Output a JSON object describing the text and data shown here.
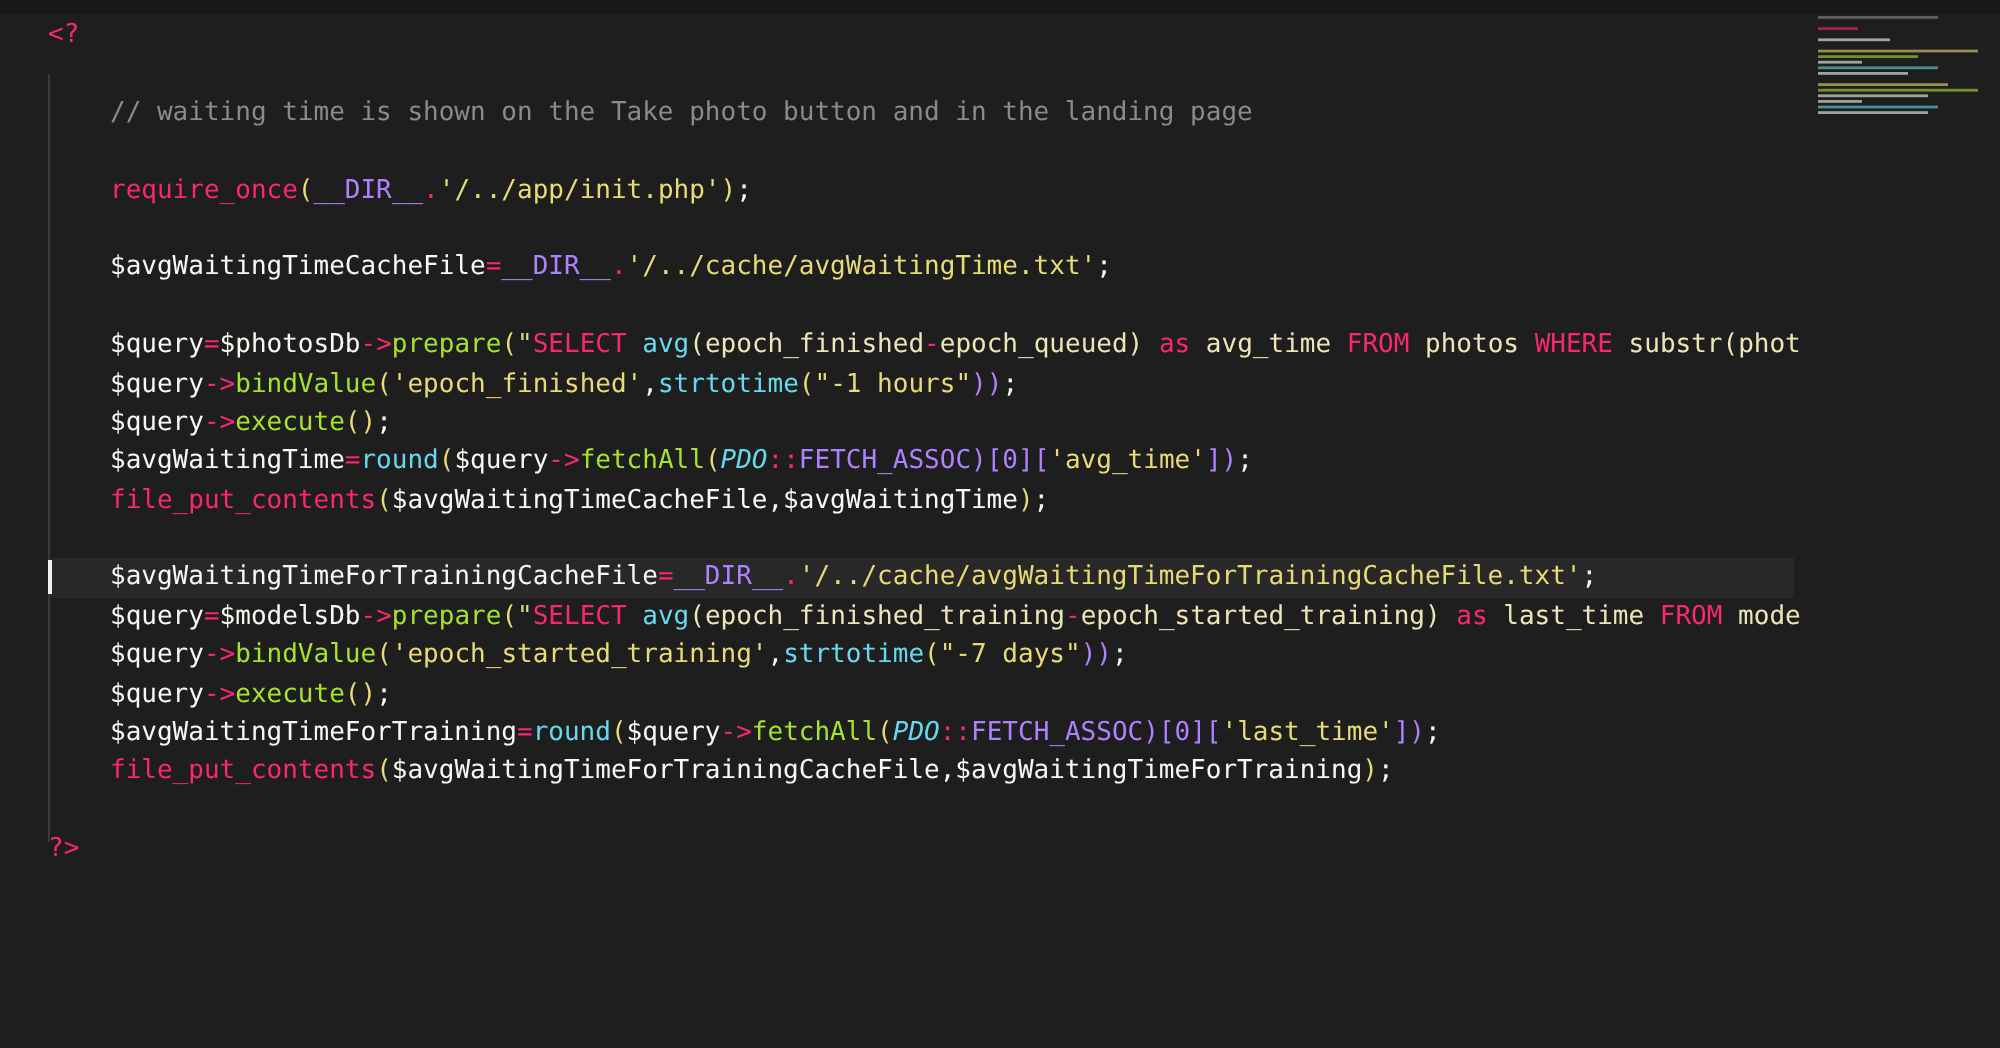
{
  "editor": {
    "lines": [
      {
        "kind": "tag",
        "current": false,
        "tokens": [
          {
            "text": "<?",
            "kind": "tag"
          }
        ]
      },
      {
        "kind": "blank"
      },
      {
        "kind": "code",
        "current": false,
        "tokens": [
          {
            "text": "// waiting time is shown on the Take photo button and in the landing page",
            "kind": "comment"
          }
        ]
      },
      {
        "kind": "blank"
      },
      {
        "kind": "code",
        "current": false,
        "tokens": [
          {
            "text": "require_once",
            "kind": "func"
          },
          {
            "text": "(",
            "kind": "paren"
          },
          {
            "text": "__DIR__",
            "kind": "const"
          },
          {
            "text": ".",
            "kind": "op"
          },
          {
            "text": "'/../app/init.php'",
            "kind": "string"
          },
          {
            "text": ")",
            "kind": "paren"
          },
          {
            "text": ";",
            "kind": "plain"
          }
        ]
      },
      {
        "kind": "blank"
      },
      {
        "kind": "code",
        "current": false,
        "tokens": [
          {
            "text": "$avgWaitingTimeCacheFile",
            "kind": "plain"
          },
          {
            "text": "=",
            "kind": "op"
          },
          {
            "text": "__DIR__",
            "kind": "const"
          },
          {
            "text": ".",
            "kind": "op"
          },
          {
            "text": "'/../cache/avgWaitingTime.txt'",
            "kind": "string"
          },
          {
            "text": ";",
            "kind": "plain"
          }
        ]
      },
      {
        "kind": "blank"
      },
      {
        "kind": "code",
        "current": false,
        "tokens": [
          {
            "text": "$query",
            "kind": "plain"
          },
          {
            "text": "=",
            "kind": "op"
          },
          {
            "text": "$photosDb",
            "kind": "plain"
          },
          {
            "text": "->",
            "kind": "op"
          },
          {
            "text": "prepare",
            "kind": "method"
          },
          {
            "text": "(\"",
            "kind": "paren"
          },
          {
            "text": "SELECT ",
            "kind": "keyword"
          },
          {
            "text": "avg",
            "kind": "builtin"
          },
          {
            "text": "(epoch_finished",
            "kind": "sql"
          },
          {
            "text": "-",
            "kind": "op"
          },
          {
            "text": "epoch_queued) ",
            "kind": "sql"
          },
          {
            "text": "as",
            "kind": "keyword"
          },
          {
            "text": " avg_time ",
            "kind": "sql"
          },
          {
            "text": "FROM",
            "kind": "keyword"
          },
          {
            "text": " photos ",
            "kind": "sql"
          },
          {
            "text": "WHERE",
            "kind": "keyword"
          },
          {
            "text": " substr(phot",
            "kind": "sql"
          }
        ]
      },
      {
        "kind": "code",
        "current": false,
        "tokens": [
          {
            "text": "$query",
            "kind": "plain"
          },
          {
            "text": "->",
            "kind": "op"
          },
          {
            "text": "bindValue",
            "kind": "method"
          },
          {
            "text": "(",
            "kind": "paren"
          },
          {
            "text": "'epoch_finished'",
            "kind": "string"
          },
          {
            "text": ",",
            "kind": "plain"
          },
          {
            "text": "strtotime",
            "kind": "builtin"
          },
          {
            "text": "(",
            "kind": "paren"
          },
          {
            "text": "\"-1 hours\"",
            "kind": "string"
          },
          {
            "text": "))",
            "kind": "const"
          },
          {
            "text": ";",
            "kind": "plain"
          }
        ]
      },
      {
        "kind": "code",
        "current": false,
        "tokens": [
          {
            "text": "$query",
            "kind": "plain"
          },
          {
            "text": "->",
            "kind": "op"
          },
          {
            "text": "execute",
            "kind": "method"
          },
          {
            "text": "()",
            "kind": "paren"
          },
          {
            "text": ";",
            "kind": "plain"
          }
        ]
      },
      {
        "kind": "code",
        "current": false,
        "tokens": [
          {
            "text": "$avgWaitingTime",
            "kind": "plain"
          },
          {
            "text": "=",
            "kind": "op"
          },
          {
            "text": "round",
            "kind": "builtin"
          },
          {
            "text": "(",
            "kind": "paren"
          },
          {
            "text": "$query",
            "kind": "plain"
          },
          {
            "text": "->",
            "kind": "op"
          },
          {
            "text": "fetchAll",
            "kind": "method"
          },
          {
            "text": "(",
            "kind": "paren"
          },
          {
            "text": "PDO",
            "kind": "class"
          },
          {
            "text": "::",
            "kind": "op"
          },
          {
            "text": "FETCH_ASSOC",
            "kind": "const"
          },
          {
            "text": ")[0][",
            "kind": "const"
          },
          {
            "text": "'avg_time'",
            "kind": "string"
          },
          {
            "text": "])",
            "kind": "const"
          },
          {
            "text": ";",
            "kind": "plain"
          }
        ]
      },
      {
        "kind": "code",
        "current": false,
        "tokens": [
          {
            "text": "file_put_contents",
            "kind": "func"
          },
          {
            "text": "(",
            "kind": "paren"
          },
          {
            "text": "$avgWaitingTimeCacheFile,$avgWaitingTime",
            "kind": "plain"
          },
          {
            "text": ")",
            "kind": "paren"
          },
          {
            "text": ";",
            "kind": "plain"
          }
        ]
      },
      {
        "kind": "blank"
      },
      {
        "kind": "code",
        "current": true,
        "tokens": [
          {
            "text": "$avgWaitingTimeForTrainingCacheFile",
            "kind": "plain"
          },
          {
            "text": "=",
            "kind": "op"
          },
          {
            "text": "__DIR__",
            "kind": "const"
          },
          {
            "text": ".",
            "kind": "op"
          },
          {
            "text": "'/../cache/avgWaitingTimeForTrainingCacheFile.txt'",
            "kind": "string"
          },
          {
            "text": ";",
            "kind": "plain"
          }
        ]
      },
      {
        "kind": "code",
        "current": false,
        "tokens": [
          {
            "text": "$query",
            "kind": "plain"
          },
          {
            "text": "=",
            "kind": "op"
          },
          {
            "text": "$modelsDb",
            "kind": "plain"
          },
          {
            "text": "->",
            "kind": "op"
          },
          {
            "text": "prepare",
            "kind": "method"
          },
          {
            "text": "(\"",
            "kind": "paren"
          },
          {
            "text": "SELECT ",
            "kind": "keyword"
          },
          {
            "text": "avg",
            "kind": "builtin"
          },
          {
            "text": "(epoch_finished_training",
            "kind": "sql"
          },
          {
            "text": "-",
            "kind": "op"
          },
          {
            "text": "epoch_started_training) ",
            "kind": "sql"
          },
          {
            "text": "as",
            "kind": "keyword"
          },
          {
            "text": " last_time ",
            "kind": "sql"
          },
          {
            "text": "FROM",
            "kind": "keyword"
          },
          {
            "text": " mode",
            "kind": "sql"
          }
        ]
      },
      {
        "kind": "code",
        "current": false,
        "tokens": [
          {
            "text": "$query",
            "kind": "plain"
          },
          {
            "text": "->",
            "kind": "op"
          },
          {
            "text": "bindValue",
            "kind": "method"
          },
          {
            "text": "(",
            "kind": "paren"
          },
          {
            "text": "'epoch_started_training'",
            "kind": "string"
          },
          {
            "text": ",",
            "kind": "plain"
          },
          {
            "text": "strtotime",
            "kind": "builtin"
          },
          {
            "text": "(",
            "kind": "paren"
          },
          {
            "text": "\"-7 days\"",
            "kind": "string"
          },
          {
            "text": "))",
            "kind": "const"
          },
          {
            "text": ";",
            "kind": "plain"
          }
        ]
      },
      {
        "kind": "code",
        "current": false,
        "tokens": [
          {
            "text": "$query",
            "kind": "plain"
          },
          {
            "text": "->",
            "kind": "op"
          },
          {
            "text": "execute",
            "kind": "method"
          },
          {
            "text": "()",
            "kind": "paren"
          },
          {
            "text": ";",
            "kind": "plain"
          }
        ]
      },
      {
        "kind": "code",
        "current": false,
        "tokens": [
          {
            "text": "$avgWaitingTimeForTraining",
            "kind": "plain"
          },
          {
            "text": "=",
            "kind": "op"
          },
          {
            "text": "round",
            "kind": "builtin"
          },
          {
            "text": "(",
            "kind": "paren"
          },
          {
            "text": "$query",
            "kind": "plain"
          },
          {
            "text": "->",
            "kind": "op"
          },
          {
            "text": "fetchAll",
            "kind": "method"
          },
          {
            "text": "(",
            "kind": "paren"
          },
          {
            "text": "PDO",
            "kind": "class"
          },
          {
            "text": "::",
            "kind": "op"
          },
          {
            "text": "FETCH_ASSOC",
            "kind": "const"
          },
          {
            "text": ")[0][",
            "kind": "const"
          },
          {
            "text": "'last_time'",
            "kind": "string"
          },
          {
            "text": "])",
            "kind": "const"
          },
          {
            "text": ";",
            "kind": "plain"
          }
        ]
      },
      {
        "kind": "code",
        "current": false,
        "tokens": [
          {
            "text": "file_put_contents",
            "kind": "func"
          },
          {
            "text": "(",
            "kind": "paren"
          },
          {
            "text": "$avgWaitingTimeForTrainingCacheFile,$avgWaitingTimeForTraining",
            "kind": "plain"
          },
          {
            "text": ")",
            "kind": "paren"
          },
          {
            "text": ";",
            "kind": "plain"
          }
        ]
      },
      {
        "kind": "blank"
      },
      {
        "kind": "tag",
        "current": false,
        "tokens": [
          {
            "text": "?>",
            "kind": "tag"
          }
        ]
      }
    ]
  }
}
